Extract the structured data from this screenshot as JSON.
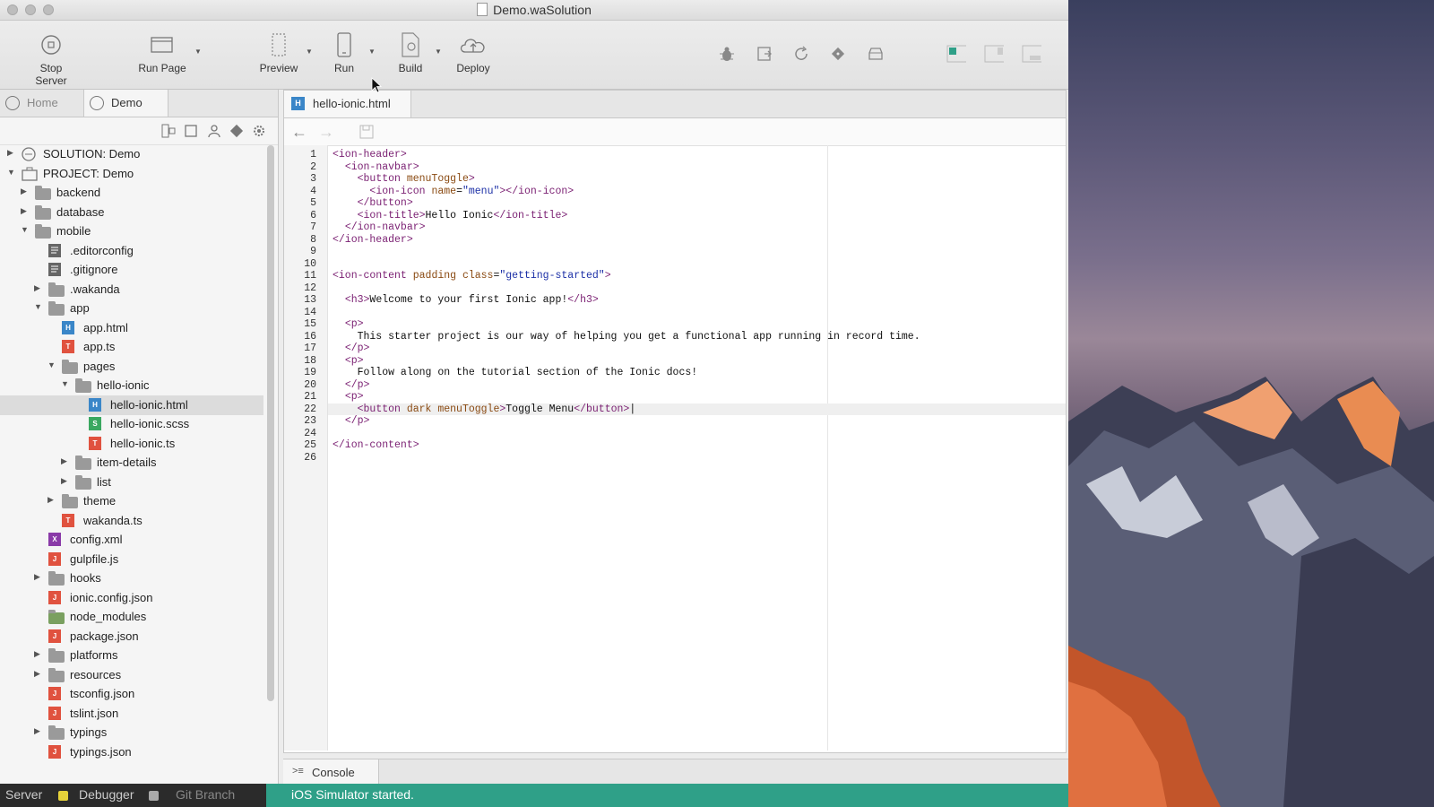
{
  "window": {
    "title": "Demo.waSolution"
  },
  "toolbar": {
    "stop_server": "Stop Server",
    "run_page": "Run Page",
    "preview": "Preview",
    "run": "Run",
    "build": "Build",
    "deploy": "Deploy"
  },
  "left_tabs": {
    "home": "Home",
    "demo": "Demo"
  },
  "tree": [
    {
      "name": "SOLUTION: Demo"
    },
    {
      "name": "PROJECT: Demo"
    },
    {
      "name": "backend"
    },
    {
      "name": "database"
    },
    {
      "name": "mobile"
    },
    {
      "name": ".editorconfig"
    },
    {
      "name": ".gitignore"
    },
    {
      "name": ".wakanda"
    },
    {
      "name": "app"
    },
    {
      "name": "app.html",
      "icon_letter": "H"
    },
    {
      "name": "app.ts",
      "icon_letter": "T"
    },
    {
      "name": "pages"
    },
    {
      "name": "hello-ionic"
    },
    {
      "name": "hello-ionic.html",
      "icon_letter": "H"
    },
    {
      "name": "hello-ionic.scss",
      "icon_letter": "S"
    },
    {
      "name": "hello-ionic.ts",
      "icon_letter": "T"
    },
    {
      "name": "item-details"
    },
    {
      "name": "list"
    },
    {
      "name": "theme"
    },
    {
      "name": "wakanda.ts",
      "icon_letter": "T"
    },
    {
      "name": "config.xml",
      "icon_letter": "X"
    },
    {
      "name": "gulpfile.js",
      "icon_letter": "J"
    },
    {
      "name": "hooks"
    },
    {
      "name": "ionic.config.json",
      "icon_letter": "J"
    },
    {
      "name": "node_modules"
    },
    {
      "name": "package.json",
      "icon_letter": "J"
    },
    {
      "name": "platforms"
    },
    {
      "name": "resources"
    },
    {
      "name": "tsconfig.json",
      "icon_letter": "J"
    },
    {
      "name": "tslint.json",
      "icon_letter": "J"
    },
    {
      "name": "typings"
    },
    {
      "name": "typings.json",
      "icon_letter": "J"
    }
  ],
  "editor": {
    "tab_title": "hello-ionic.html",
    "tab_icon_letter": "H",
    "current_line": 22,
    "line_numbers": [
      "1",
      "2",
      "3",
      "4",
      "5",
      "6",
      "7",
      "8",
      "9",
      "10",
      "11",
      "12",
      "13",
      "14",
      "15",
      "16",
      "17",
      "18",
      "19",
      "20",
      "21",
      "22",
      "23",
      "24",
      "25",
      "26"
    ]
  },
  "console": {
    "label": "Console"
  },
  "status": {
    "server": "Server",
    "debugger": "Debugger",
    "git_branch": "Git Branch",
    "message": "iOS Simulator started."
  },
  "colors": {
    "status_green": "#2fa088",
    "html_icon": "#3a86c8",
    "ts_icon": "#e0523f"
  }
}
